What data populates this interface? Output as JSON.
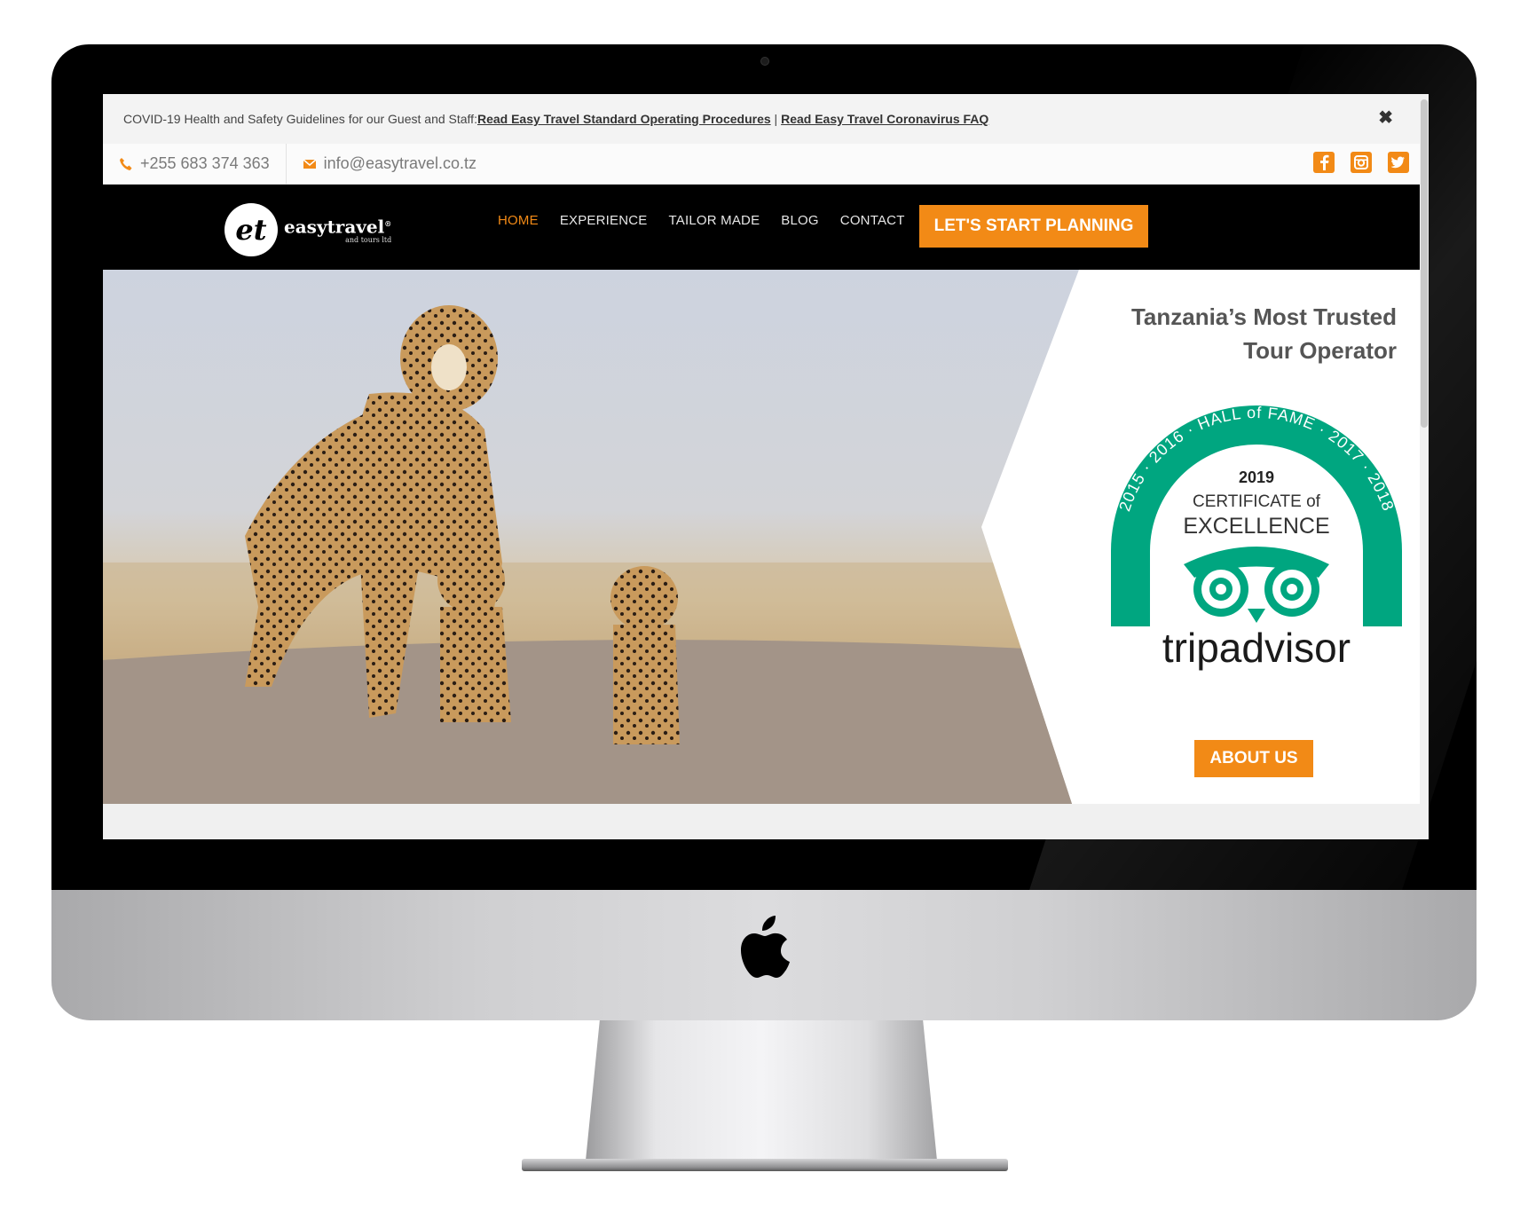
{
  "notice": {
    "text": "COVID-19 Health and Safety Guidelines for our Guest and Staff: ",
    "link1": "Read Easy Travel Standard Operating Procedures",
    "separator": " | ",
    "link2": "Read Easy Travel Coronavirus FAQ",
    "close": "✖"
  },
  "contact": {
    "phone": "+255 683 374 363",
    "email": "info@easytravel.co.tz",
    "social": [
      "facebook-icon",
      "instagram-icon",
      "twitter-icon"
    ]
  },
  "logo": {
    "mark": "et",
    "name": "easytravel",
    "sub": "and tours ltd"
  },
  "nav": {
    "links": [
      {
        "label": "HOME",
        "active": true
      },
      {
        "label": "EXPERIENCE",
        "active": false
      },
      {
        "label": "TAILOR MADE",
        "active": false
      },
      {
        "label": "BLOG",
        "active": false
      },
      {
        "label": "CONTACT",
        "active": false
      }
    ],
    "cta": "LET'S START PLANNING"
  },
  "hero": {
    "headline_line1": "Tanzania’s Most Trusted",
    "headline_line2": "Tour Operator",
    "badge": {
      "arc_text": "2015 · 2016 · HALL of FAME · 2017 · 2018",
      "year": "2019",
      "line1": "CERTIFICATE of",
      "line2": "EXCELLENCE",
      "brand": "tripadvisor"
    },
    "about_button": "ABOUT US"
  },
  "colors": {
    "accent": "#f28a16",
    "nav_bg": "#000000",
    "badge_green": "#00a680",
    "headline": "#555555"
  }
}
